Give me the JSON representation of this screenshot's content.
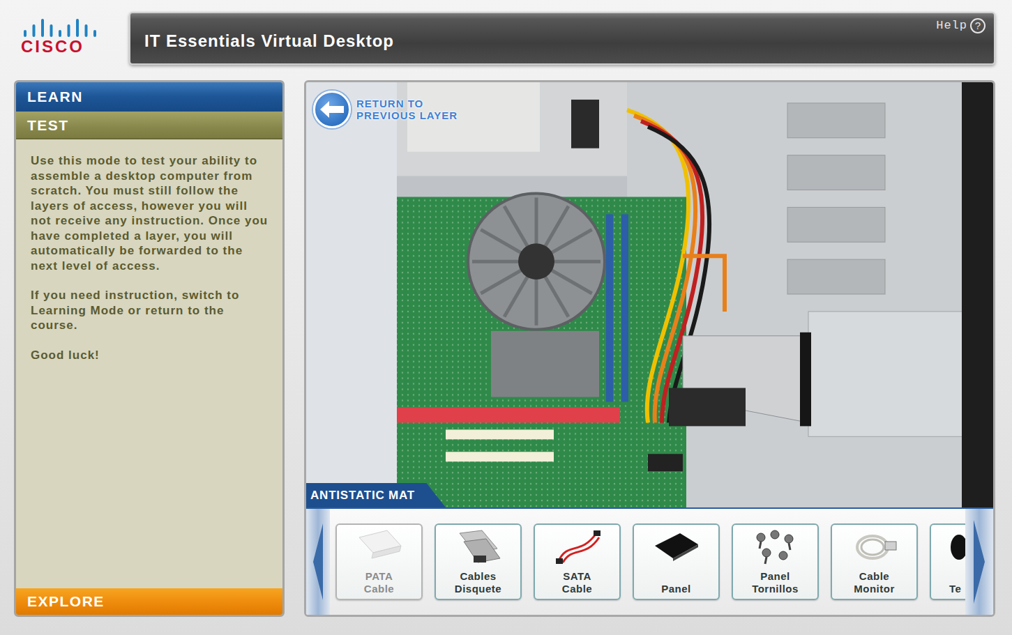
{
  "logo": {
    "text": "CISCO"
  },
  "header": {
    "title": "IT Essentials Virtual Desktop",
    "help": "Help",
    "help_icon": "?"
  },
  "sidebar": {
    "tabs": [
      {
        "label": "LEARN",
        "selected": false
      },
      {
        "label": "TEST",
        "selected": true
      }
    ],
    "paragraphs": [
      "Use this mode to test your ability to assemble a desktop computer from scratch. You must still follow the layers of access, however you will not receive any instruction. Once you have completed a layer, you will automatically be forwarded to the next level of access.",
      "If you need instruction, switch to Learning Mode or return to the course.",
      "Good luck!"
    ],
    "footer": "EXPLORE"
  },
  "scene": {
    "return_label": [
      "RETURN TO",
      "PREVIOUS LAYER"
    ],
    "layer_label": "ANTISTATIC MAT"
  },
  "toolbar": {
    "items": [
      {
        "label": "PATA Cable",
        "disabled": true
      },
      {
        "label": "Cables Disquete",
        "disabled": false
      },
      {
        "label": "SATA Cable",
        "disabled": false
      },
      {
        "label": "Panel",
        "disabled": false
      },
      {
        "label": "Panel Tornillos",
        "disabled": false
      },
      {
        "label": "Cable Monitor",
        "disabled": false
      },
      {
        "label": "Te",
        "disabled": false
      }
    ]
  }
}
